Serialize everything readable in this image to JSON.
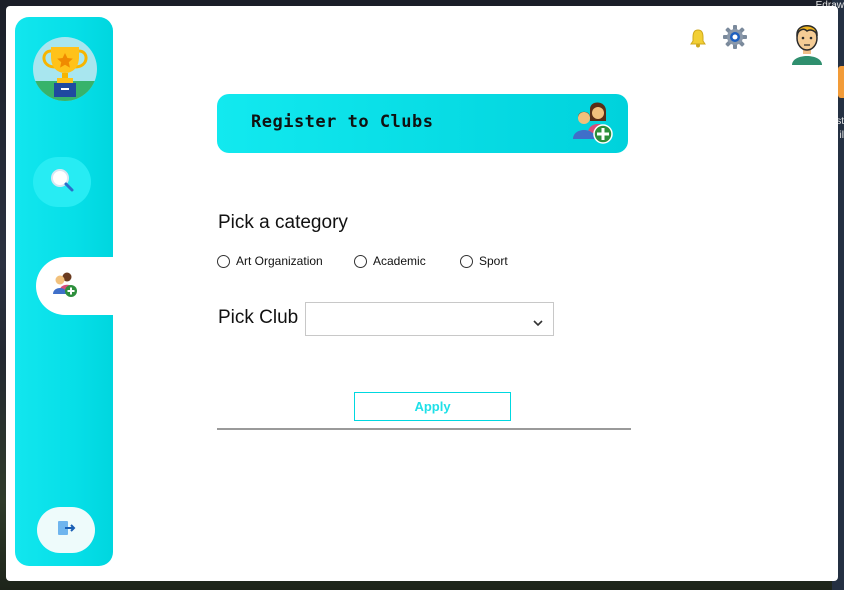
{
  "background": {
    "snippet_top": "Edraw",
    "snippet_mid1": "st",
    "snippet_mid2": "il"
  },
  "sidebar": {
    "logo_icon": "trophy-icon",
    "items": [
      {
        "name": "search",
        "icon": "search-icon"
      },
      {
        "name": "register-clubs",
        "icon": "add-group-icon",
        "active": true
      },
      {
        "name": "logout",
        "icon": "logout-icon"
      }
    ]
  },
  "topbar": {
    "icons": [
      "bell-icon",
      "gear-icon",
      "user-avatar-icon"
    ]
  },
  "banner": {
    "title": "Register to Clubs",
    "icon": "add-group-icon"
  },
  "form": {
    "category_label": "Pick a category",
    "categories": [
      {
        "label": "Art Organization",
        "checked": false
      },
      {
        "label": "Academic",
        "checked": false
      },
      {
        "label": "Sport",
        "checked": false
      }
    ],
    "club_label": "Pick Club",
    "club_value": "",
    "apply_label": "Apply"
  },
  "colors": {
    "accent": "#00DDE6",
    "accent_light": "#27ECF3",
    "text": "#111111"
  }
}
